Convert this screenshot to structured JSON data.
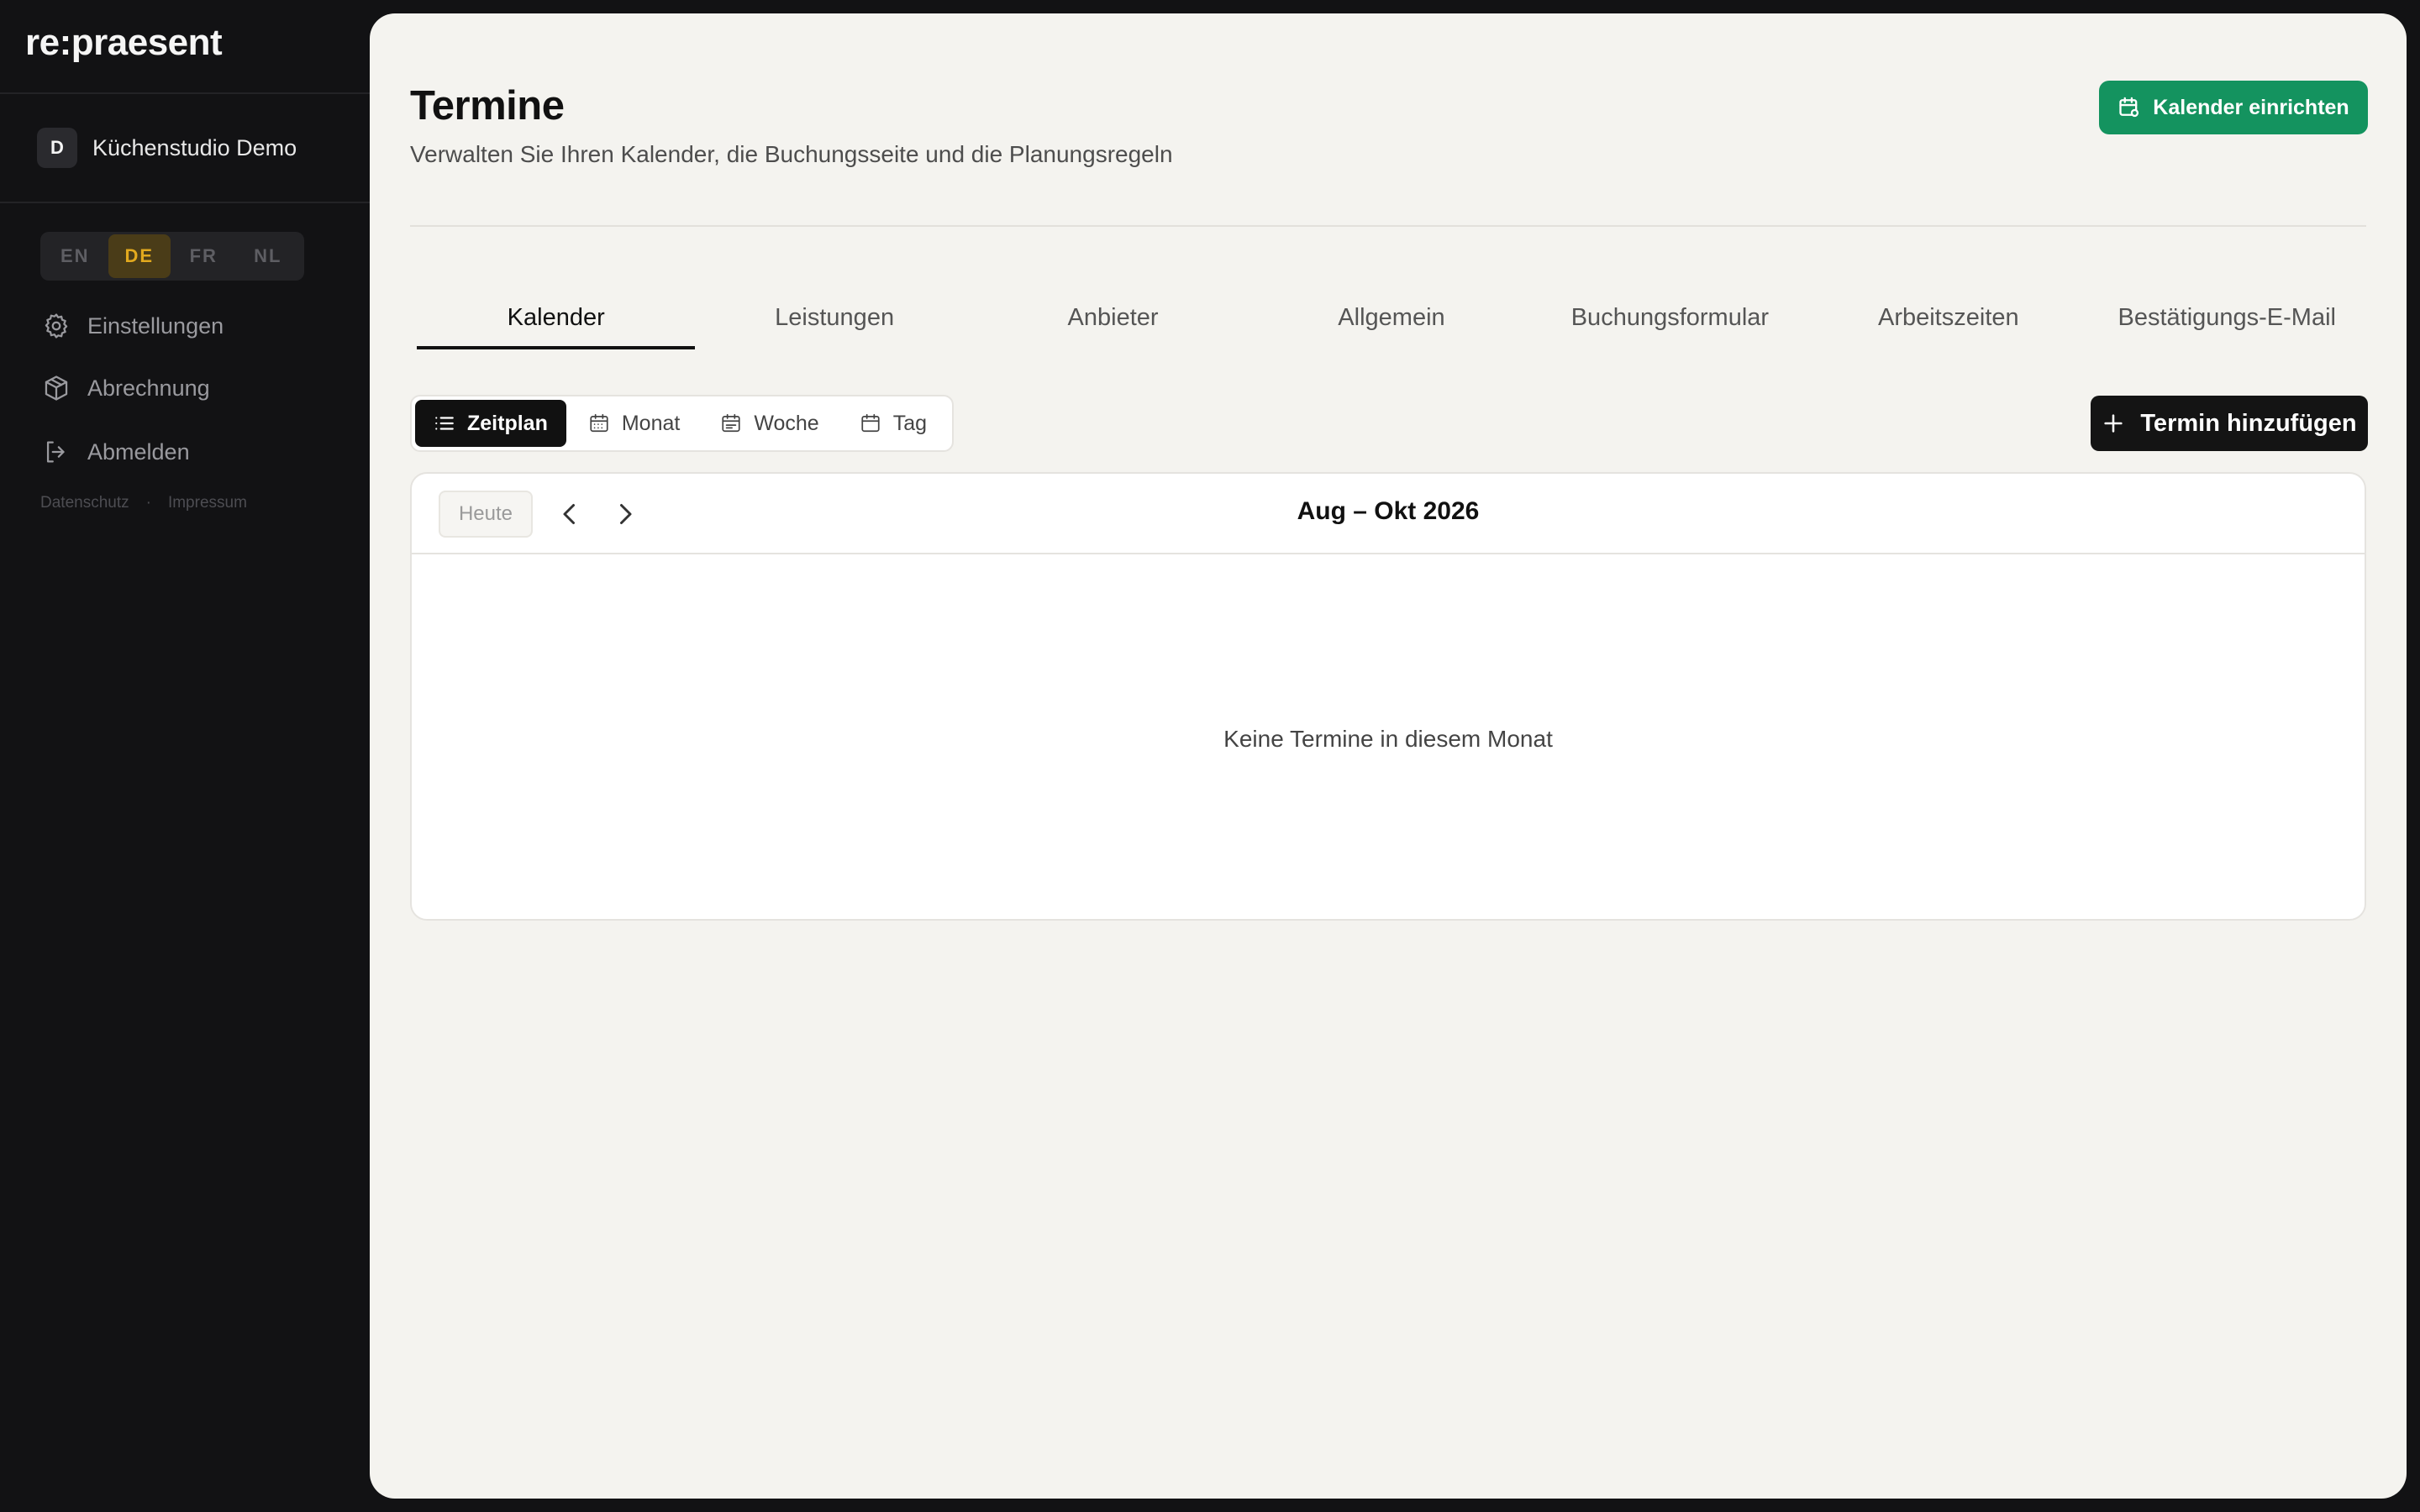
{
  "app": {
    "logo": "re:praesent"
  },
  "workspace": {
    "initial": "D",
    "name": "Küchenstudio Demo"
  },
  "languages": [
    {
      "code": "EN",
      "active": false
    },
    {
      "code": "DE",
      "active": true
    },
    {
      "code": "FR",
      "active": false
    },
    {
      "code": "NL",
      "active": false
    }
  ],
  "nav": {
    "settings": "Einstellungen",
    "billing": "Abrechnung",
    "logout": "Abmelden"
  },
  "legal": {
    "privacy": "Datenschutz",
    "separator": "·",
    "imprint": "Impressum"
  },
  "page": {
    "title": "Termine",
    "subtitle": "Verwalten Sie Ihren Kalender, die Buchungsseite und die Planungsregeln",
    "setup_button": "Kalender einrichten"
  },
  "tabs": [
    "Kalender",
    "Leistungen",
    "Anbieter",
    "Allgemein",
    "Buchungsformular",
    "Arbeitszeiten",
    "Bestätigungs-E-Mail"
  ],
  "active_tab": "Kalender",
  "views": {
    "schedule": "Zeitplan",
    "month": "Monat",
    "week": "Woche",
    "day": "Tag",
    "active": "Zeitplan"
  },
  "add_button": "Termin hinzufügen",
  "calendar": {
    "today_button": "Heute",
    "range": "Aug – Okt 2026",
    "empty_text": "Keine Termine in diesem Monat"
  },
  "colors": {
    "sidebar_bg": "#121214",
    "main_bg": "#f4f3ef",
    "accent_green": "#14935f",
    "lang_active": "#e2a91e",
    "primary_dark": "#141414"
  }
}
